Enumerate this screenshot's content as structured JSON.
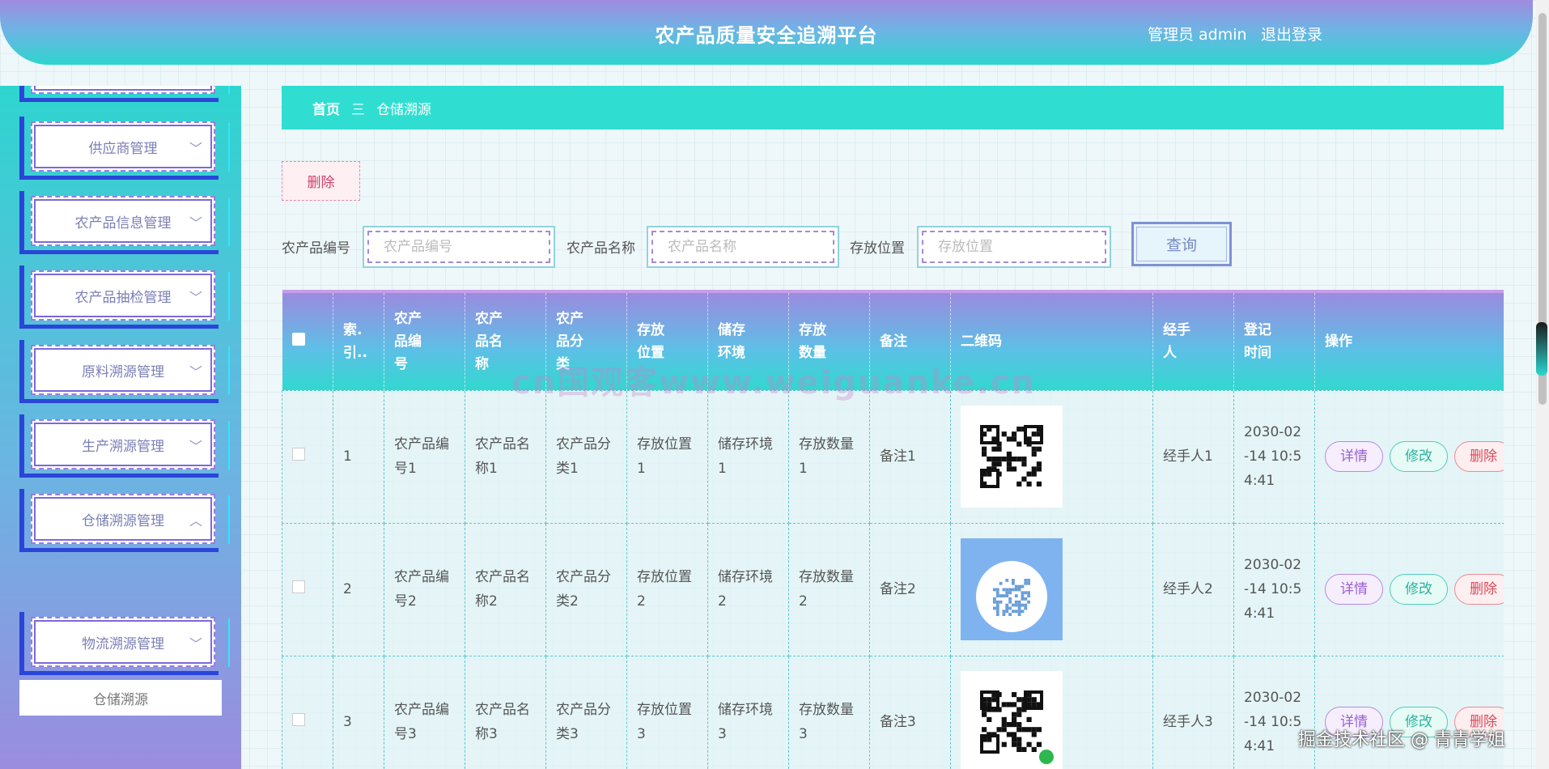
{
  "header": {
    "title": "农产品质量安全追溯平台",
    "user_role": "管理员",
    "username": "admin",
    "logout_label": "退出登录"
  },
  "sidebar": {
    "items": [
      {
        "label": "供应商管理",
        "chevron": "﹀"
      },
      {
        "label": "农产品信息管理",
        "chevron": "﹀"
      },
      {
        "label": "农产品抽检管理",
        "chevron": "﹀"
      },
      {
        "label": "原料溯源管理",
        "chevron": "﹀"
      },
      {
        "label": "生产溯源管理",
        "chevron": "﹀"
      },
      {
        "label": "仓储溯源管理",
        "chevron": "︿"
      },
      {
        "label": "物流溯源管理",
        "chevron": "﹀"
      }
    ],
    "active_submenu": "仓储溯源"
  },
  "breadcrumb": {
    "home": "首页",
    "separator": "三",
    "current": "仓储溯源"
  },
  "toolbar": {
    "delete_label": "删除"
  },
  "search": {
    "code_label": "农产品编号",
    "code_placeholder": "农产品编号",
    "name_label": "农产品名称",
    "name_placeholder": "农产品名称",
    "location_label": "存放位置",
    "location_placeholder": "存放位置",
    "query_label": "查询"
  },
  "table": {
    "headers": [
      "索引",
      "农产品编号",
      "农产品名称",
      "农产品分类",
      "存放位置",
      "储存环境",
      "存放数量",
      "备注",
      "二维码",
      "经手人",
      "登记时间",
      "操作"
    ],
    "header_display": [
      "索.\n引..",
      "农产\n品编\n号",
      "农产\n品名\n称",
      "农产\n品分\n类",
      "存放\n位置",
      "储存\n环境",
      "存放\n数量",
      "备注",
      "二维码",
      "经手\n人",
      "登记\n时间",
      "操作"
    ],
    "rows": [
      {
        "index": "1",
        "code": "农产品编号1",
        "name": "农产品名称1",
        "category": "农产品分类1",
        "location": "存放位置1",
        "env": "储存环境1",
        "qty": "存放数量1",
        "note": "备注1",
        "handler": "经手人1",
        "time": "2030-02-14 10:54:41"
      },
      {
        "index": "2",
        "code": "农产品编号2",
        "name": "农产品名称2",
        "category": "农产品分类2",
        "location": "存放位置2",
        "env": "储存环境2",
        "qty": "存放数量2",
        "note": "备注2",
        "handler": "经手人2",
        "time": "2030-02-14 10:54:41"
      },
      {
        "index": "3",
        "code": "农产品编号3",
        "name": "农产品名称3",
        "category": "农产品分类3",
        "location": "存放位置3",
        "env": "储存环境3",
        "qty": "存放数量3",
        "note": "备注3",
        "handler": "经手人3",
        "time": "2030-02-14 10:54:41"
      }
    ],
    "actions": {
      "detail": "详情",
      "edit": "修改",
      "delete": "删除"
    }
  },
  "watermarks": {
    "center": "cn国观客www.weiguanke.cn",
    "corner": "掘金技术社区 @ 青青学姐"
  },
  "colors": {
    "accent_teal": "#2fded0",
    "accent_purple": "#9d89df",
    "sidebar_border": "#2a45d8"
  }
}
